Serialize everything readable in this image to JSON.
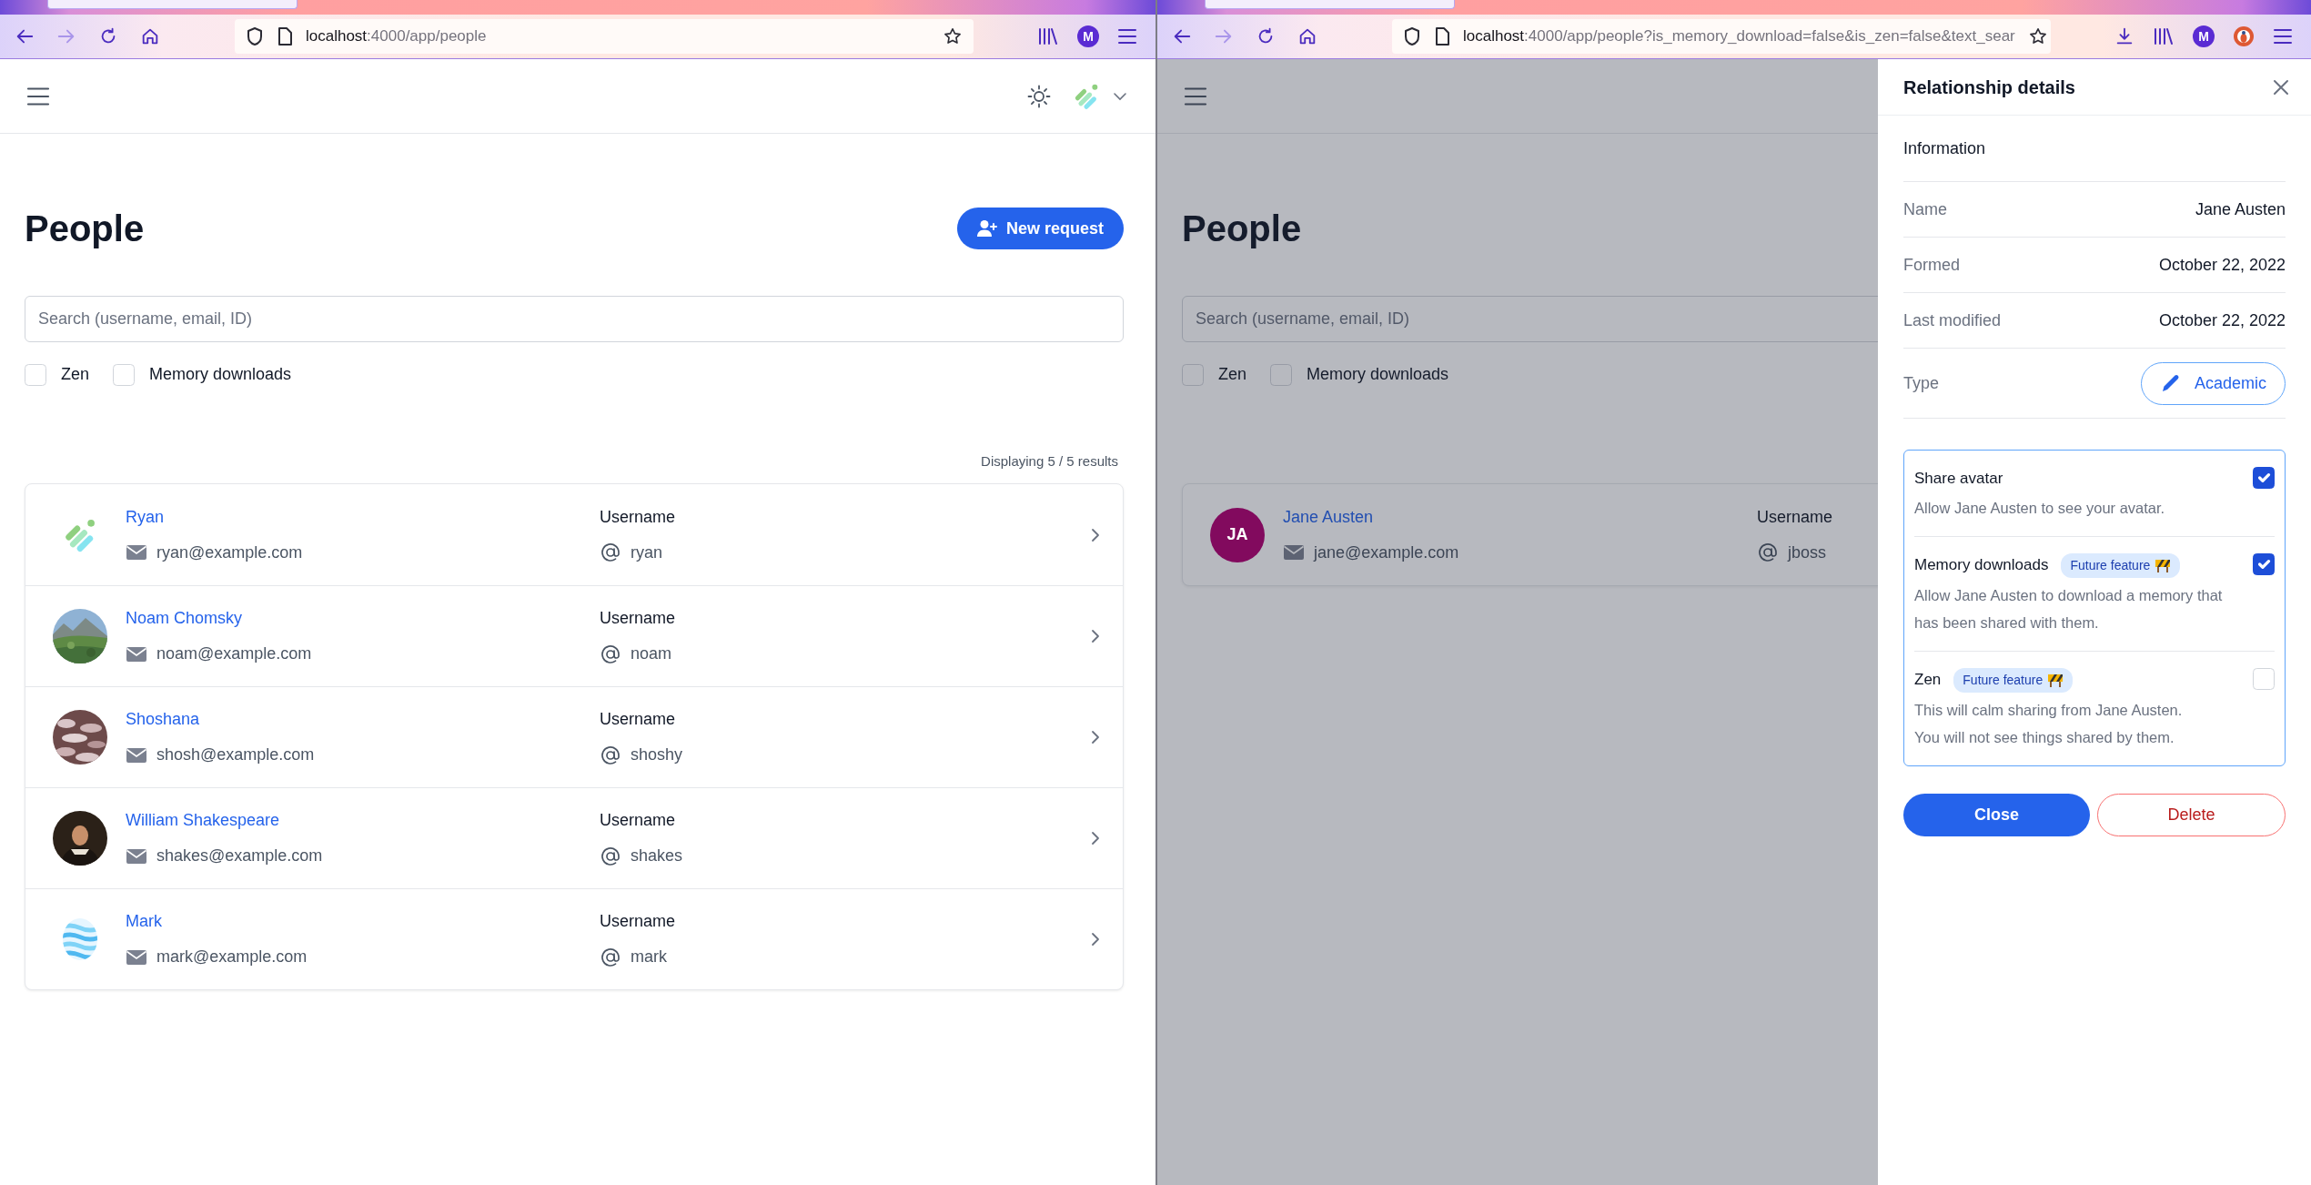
{
  "windows": [
    {
      "browser": {
        "url_host": "localhost",
        "url_path": ":4000/app/people",
        "tools": [
          {
            "kind": "library"
          },
          {
            "kind": "account",
            "label": "M"
          },
          {
            "kind": "menu"
          }
        ]
      },
      "page": {
        "title": "People",
        "new_request": "New request",
        "search": {
          "placeholder": "Search (username, email, ID)"
        },
        "filters": [
          {
            "label": "Zen",
            "checked": false
          },
          {
            "label": "Memory downloads",
            "checked": false
          }
        ],
        "results": "Displaying 5 / 5 results",
        "people": [
          {
            "name": "Ryan",
            "email": "ryan@example.com",
            "username_label": "Username",
            "username": "ryan",
            "avatar": {
              "kind": "leaf"
            }
          },
          {
            "name": "Noam Chomsky",
            "email": "noam@example.com",
            "username_label": "Username",
            "username": "noam"
          },
          {
            "name": "Shoshana",
            "email": "shosh@example.com",
            "username_label": "Username",
            "username": "shoshy"
          },
          {
            "name": "William Shakespeare",
            "email": "shakes@example.com",
            "username_label": "Username",
            "username": "shakes"
          },
          {
            "name": "Mark",
            "email": "mark@example.com",
            "username_label": "Username",
            "username": "mark",
            "avatar": {
              "kind": "waves"
            }
          }
        ]
      }
    },
    {
      "browser": {
        "url_host": "localhost",
        "url_path": ":4000/app/people?is_memory_download=false&is_zen=false&text_sear",
        "tools": [
          {
            "kind": "download"
          },
          {
            "kind": "library"
          },
          {
            "kind": "account",
            "label": "M"
          },
          {
            "kind": "extension"
          },
          {
            "kind": "menu"
          }
        ]
      },
      "page": {
        "title": "People",
        "search": {
          "placeholder": "Search (username, email, ID)"
        },
        "filters": [
          {
            "label": "Zen",
            "checked": false
          },
          {
            "label": "Memory downloads",
            "checked": false
          }
        ],
        "people": [
          {
            "name": "Jane Austen",
            "email": "jane@example.com",
            "username_label": "Username",
            "username": "jboss",
            "avatar": {
              "kind": "initials",
              "initials": "JA",
              "color": "#820a5e"
            }
          }
        ]
      },
      "panel": {
        "title": "Relationship details",
        "section": "Information",
        "fields": [
          {
            "label": "Name",
            "value": "Jane Austen"
          },
          {
            "label": "Formed",
            "value": "October 22, 2022"
          },
          {
            "label": "Last modified",
            "value": "October 22, 2022"
          }
        ],
        "type": {
          "label": "Type",
          "value": "Academic"
        },
        "settings": [
          {
            "title": "Share avatar",
            "description": [
              "Allow Jane Austen to see your avatar."
            ],
            "checked": true
          },
          {
            "title": "Memory downloads",
            "badge": "Future feature",
            "description": [
              "Allow Jane Austen to download a memory that has been shared with them."
            ],
            "checked": true
          },
          {
            "title": "Zen",
            "badge": "Future feature",
            "description": [
              "This will calm sharing from Jane Austen.",
              "You will not see things shared by them."
            ],
            "checked": false
          }
        ],
        "buttons": [
          {
            "label": "Close",
            "kind": "primary"
          },
          {
            "label": "Delete",
            "kind": "danger"
          }
        ]
      }
    }
  ]
}
